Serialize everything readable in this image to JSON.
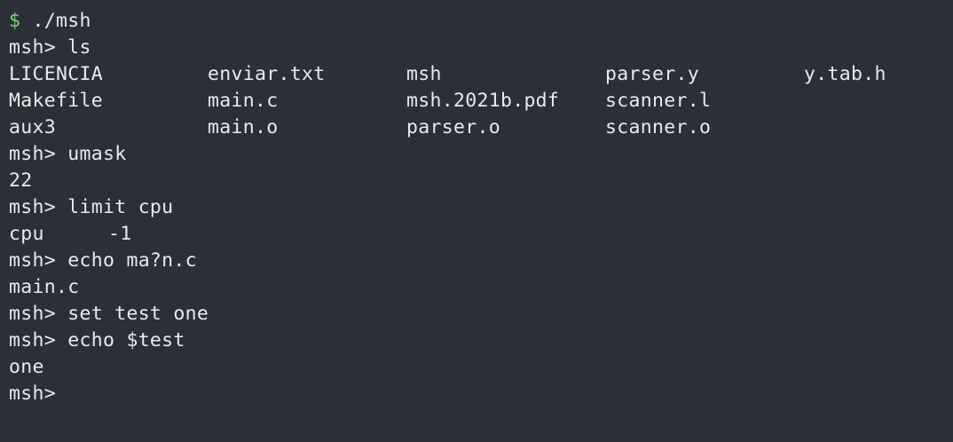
{
  "colors": {
    "background": "#2b2f37",
    "text": "#e8eaed",
    "shell_prompt": "#7fd37b"
  },
  "terminal": {
    "start": {
      "prompt": "$",
      "command": " ./msh"
    },
    "msh_prompt": "msh>",
    "commands": {
      "ls": " ls",
      "umask": " umask",
      "limit": " limit cpu",
      "echo_glob": " echo ma?n.c",
      "set": " set test one",
      "echo_var": " echo $test"
    },
    "ls_output": [
      [
        "LICENCIA",
        "enviar.txt",
        "msh",
        "parser.y",
        "y.tab.h"
      ],
      [
        "Makefile",
        "main.c",
        "msh.2021b.pdf",
        "scanner.l"
      ],
      [
        "aux3",
        "main.o",
        "parser.o",
        "scanner.o"
      ]
    ],
    "umask_output": "22",
    "limit_output": {
      "resource": "cpu",
      "value": "-1"
    },
    "echo_glob_output": "main.c",
    "echo_var_output": "one"
  }
}
